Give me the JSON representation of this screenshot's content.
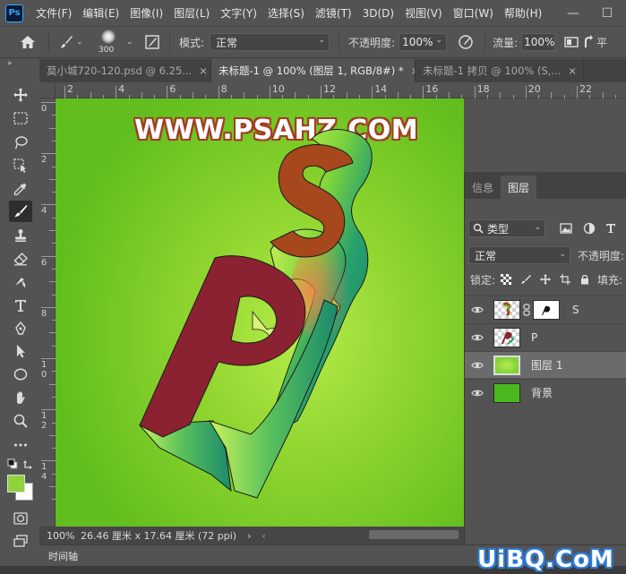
{
  "app": {
    "logo": "Ps"
  },
  "menu": {
    "items": [
      "文件(F)",
      "编辑(E)",
      "图像(I)",
      "图层(L)",
      "文字(Y)",
      "选择(S)",
      "滤镜(T)",
      "3D(D)",
      "视图(V)",
      "窗口(W)",
      "帮助(H)"
    ]
  },
  "window_controls": {
    "minimize": "—",
    "maximize": "☐"
  },
  "options_bar": {
    "brush_size": "300",
    "mode_label": "模式:",
    "mode_value": "正常",
    "opacity_label": "不透明度:",
    "opacity_value": "100%",
    "flow_label": "流量:",
    "flow_value": "100%",
    "smoothing_label": "平"
  },
  "tabs": [
    {
      "label": "莫小城720-120.psd @ 6.25...",
      "close": "×"
    },
    {
      "label": "未标题-1 @ 100% (图层 1, RGB/8#) *",
      "close": "×"
    },
    {
      "label": "未标题-1 拷贝 @ 100% (S,...",
      "close": "×"
    }
  ],
  "collapse_label": "»",
  "ruler_h": [
    "2",
    "4",
    "6",
    "8",
    "10",
    "12",
    "14",
    "16",
    "18",
    "20",
    "22"
  ],
  "ruler_v": [
    "0",
    "2",
    "4",
    "6",
    "8",
    "1\n0",
    "1\n2",
    "1\n4"
  ],
  "canvas": {
    "watermark": "WWW.PSAHZ.COM",
    "letter_back": "S",
    "letter_front": "P",
    "colors": {
      "bg_center": "#b6ec4a",
      "bg_edge": "#62be1e",
      "letter_face_p": "#8b2232",
      "letter_face_s": "#a6471c",
      "extrusion_green": "#1f8c6a",
      "extrusion_light": "#b9ef4e"
    }
  },
  "status": {
    "zoom": "100%",
    "doc_size": "26.46 厘米 x 17.64 厘米 (72 ppi)",
    "arrow": "›",
    "scroll_left": "‹"
  },
  "timeline_label": "时间轴",
  "layers_panel": {
    "tabs": [
      "信息",
      "图层"
    ],
    "filter_kind": "类型",
    "blend_mode": "正常",
    "opacity_label": "不透明度:",
    "lock_label": "锁定:",
    "fill_label": "填充:",
    "layers": [
      {
        "name": "S",
        "has_mask": true,
        "selected": false
      },
      {
        "name": "P",
        "has_mask": false,
        "selected": false
      },
      {
        "name": "图层 1",
        "has_mask": false,
        "selected": true
      },
      {
        "name": "背景",
        "has_mask": false,
        "selected": false
      }
    ]
  },
  "site_watermark": "UiBQ.CoM",
  "swatches": {
    "foreground": "#8ed23e",
    "background": "#ffffff"
  }
}
